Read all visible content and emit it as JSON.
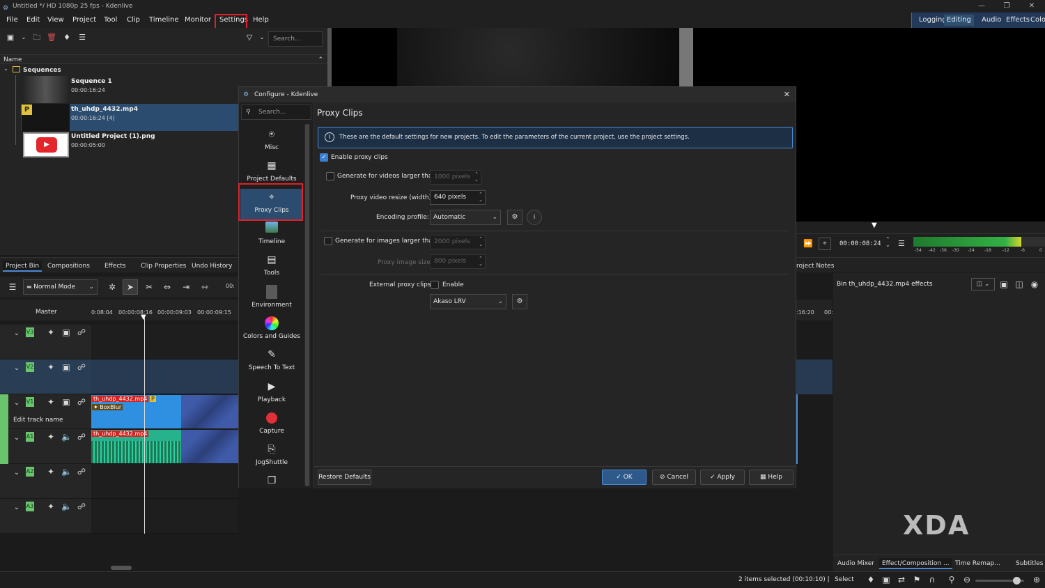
{
  "app": {
    "window_title": "Untitled */ HD 1080p 25 fps - Kdenlive",
    "window_controls": [
      "minimize-icon",
      "restore-icon",
      "close-icon"
    ]
  },
  "menubar": {
    "items": [
      "File",
      "Edit",
      "View",
      "Project",
      "Tool",
      "Clip",
      "Timeline",
      "Monitor",
      "Settings",
      "Help"
    ],
    "highlighted": "Settings"
  },
  "workspaces": {
    "items": [
      "Logging",
      "Editing",
      "Audio",
      "Effects",
      "Color"
    ],
    "active": "Editing"
  },
  "bin": {
    "search_placeholder": "Search...",
    "column_header": "Name",
    "folder": "Sequences",
    "clips": [
      {
        "name": "Sequence 1",
        "duration": "00:00:16:24"
      },
      {
        "name": "th_uhdp_4432.mp4",
        "duration": "00:00:16:24 [4]",
        "badge": "P"
      },
      {
        "name": "Untitled Project (1).png",
        "duration": "00:00:05:00"
      }
    ]
  },
  "bottom_tabs": [
    "Project Bin",
    "Compositions",
    "Effects",
    "Clip Properties",
    "Undo History"
  ],
  "timeline": {
    "mode": "Normal Mode",
    "timecode_stub": "00:",
    "master_label": "Master",
    "ruler_ticks": [
      "0:08:04",
      "00:00:08:16",
      "00:00:09:03",
      "00:00:09:15"
    ],
    "ruler_right_ticks": [
      ":16:20",
      "00:"
    ],
    "tracks": [
      "V3",
      "V2",
      "V1",
      "A1",
      "A2",
      "A3"
    ],
    "edit_track_name": "Edit track name",
    "clip_video": "th_uhdp_4432.mp4",
    "clip_video_badge": "P",
    "clip_effect": "BoxBlur",
    "clip_audio": "th_uhdp_4432.mp4"
  },
  "monitor": {
    "timecode": "00:00:08:24",
    "meter_labels": [
      "-54",
      "-42",
      "-36",
      "-30",
      "-24",
      "-18",
      "-12",
      "-6",
      "0"
    ],
    "notes_tab": "roject Notes"
  },
  "effects_panel": {
    "title": "Bin th_uhdp_4432.mp4 effects",
    "tabs": [
      "Audio Mixer",
      "Effect/Composition ...",
      "Time Remap...",
      "Subtitles"
    ]
  },
  "dialog": {
    "title": "Configure - Kdenlive",
    "search_placeholder": "Search...",
    "page_title": "Proxy Clips",
    "sidebar": [
      {
        "label": "Misc",
        "icon": "sliders-icon"
      },
      {
        "label": "Project Defaults",
        "icon": "film-frame-icon"
      },
      {
        "label": "Proxy Clips",
        "icon": "proxy-crop-icon"
      },
      {
        "label": "Timeline",
        "icon": "timeline-image-icon"
      },
      {
        "label": "Tools",
        "icon": "toolbox-icon"
      },
      {
        "label": "Environment",
        "icon": "document-icon"
      },
      {
        "label": "Colors and Guides",
        "icon": "color-wheel-icon"
      },
      {
        "label": "Speech To Text",
        "icon": "speech-icon"
      },
      {
        "label": "Playback",
        "icon": "play-icon"
      },
      {
        "label": "Capture",
        "icon": "record-icon"
      },
      {
        "label": "JogShuttle",
        "icon": "jogshuttle-icon"
      }
    ],
    "active_page": "Proxy Clips",
    "info_text": "These are the default settings for new projects. To edit the parameters of the current project, use the project settings.",
    "enable_proxy_label": "Enable proxy clips",
    "enable_proxy_checked": true,
    "gen_videos_label": "Generate for videos larger than",
    "gen_videos_value": "1000 pixels",
    "gen_videos_checked": false,
    "resize_label": "Proxy video resize (width):",
    "resize_value": "640 pixels",
    "encoding_label": "Encoding profile:",
    "encoding_value": "Automatic",
    "gen_images_label": "Generate for images larger than",
    "gen_images_value": "2000 pixels",
    "gen_images_checked": false,
    "image_size_label": "Proxy image size",
    "image_size_value": "800 pixels",
    "external_label": "External proxy clips:",
    "external_enable_label": "Enable",
    "external_enabled": false,
    "external_profile": "Akaso LRV",
    "buttons": {
      "restore": "Restore Defaults",
      "ok": "OK",
      "cancel": "Cancel",
      "apply": "Apply",
      "help": "Help"
    }
  },
  "statusbar": {
    "selection": "2 items selected (00:10:10) |",
    "tool": "Select"
  },
  "watermark": "XDA"
}
